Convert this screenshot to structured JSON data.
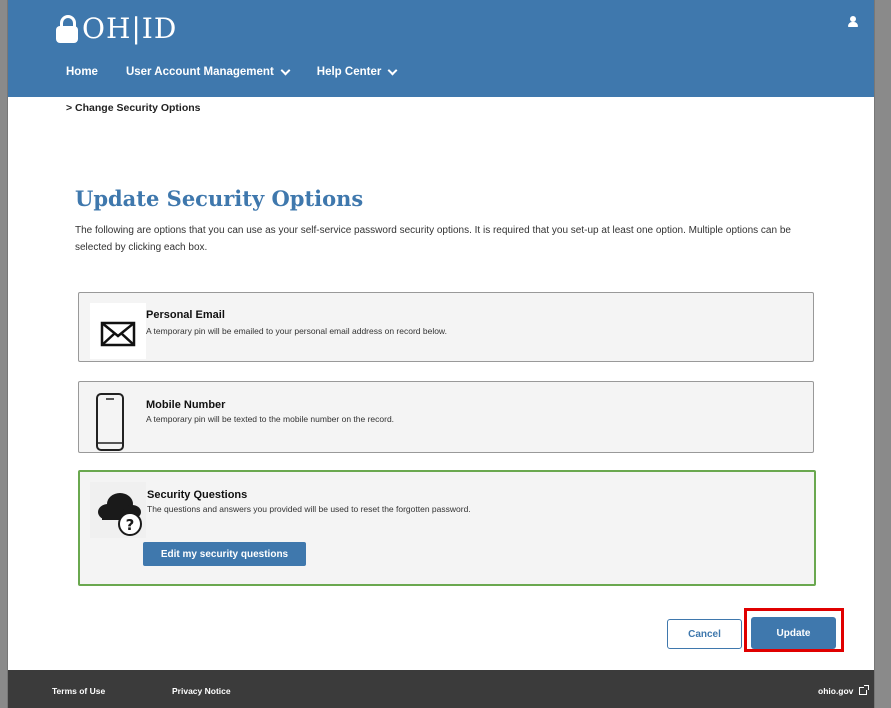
{
  "header": {
    "brand": "OH|ID",
    "nav": [
      {
        "label": "Home"
      },
      {
        "label": "User Account Management"
      },
      {
        "label": "Help Center"
      }
    ]
  },
  "breadcrumb": ">  Change Security Options",
  "page": {
    "title": "Update Security Options",
    "description": "The following are options that you can use as your self-service password security options. It is required that you set-up at least one option. Multiple options can be selected by clicking each box."
  },
  "options": [
    {
      "title": "Personal Email",
      "description": "A temporary pin will be emailed to your personal email address on record below.",
      "icon": "envelope-icon",
      "selected": false
    },
    {
      "title": "Mobile Number",
      "description": "A temporary pin will be texted to the mobile number on the record.",
      "icon": "mobile-phone-icon",
      "selected": false
    },
    {
      "title": "Security Questions",
      "description": "The questions and answers you provided will be used to reset the forgotten password.",
      "icon": "cloud-question-icon",
      "selected": true,
      "action_label": "Edit my security questions"
    }
  ],
  "actions": {
    "cancel_label": "Cancel",
    "update_label": "Update"
  },
  "footer": {
    "terms": "Terms of Use",
    "privacy": "Privacy Notice",
    "site": "ohio.gov"
  },
  "colors": {
    "brand_blue": "#3f78ad",
    "selected_border": "#6aa84f",
    "highlight": "#e00000",
    "footer_bg": "#3b3b3b"
  }
}
